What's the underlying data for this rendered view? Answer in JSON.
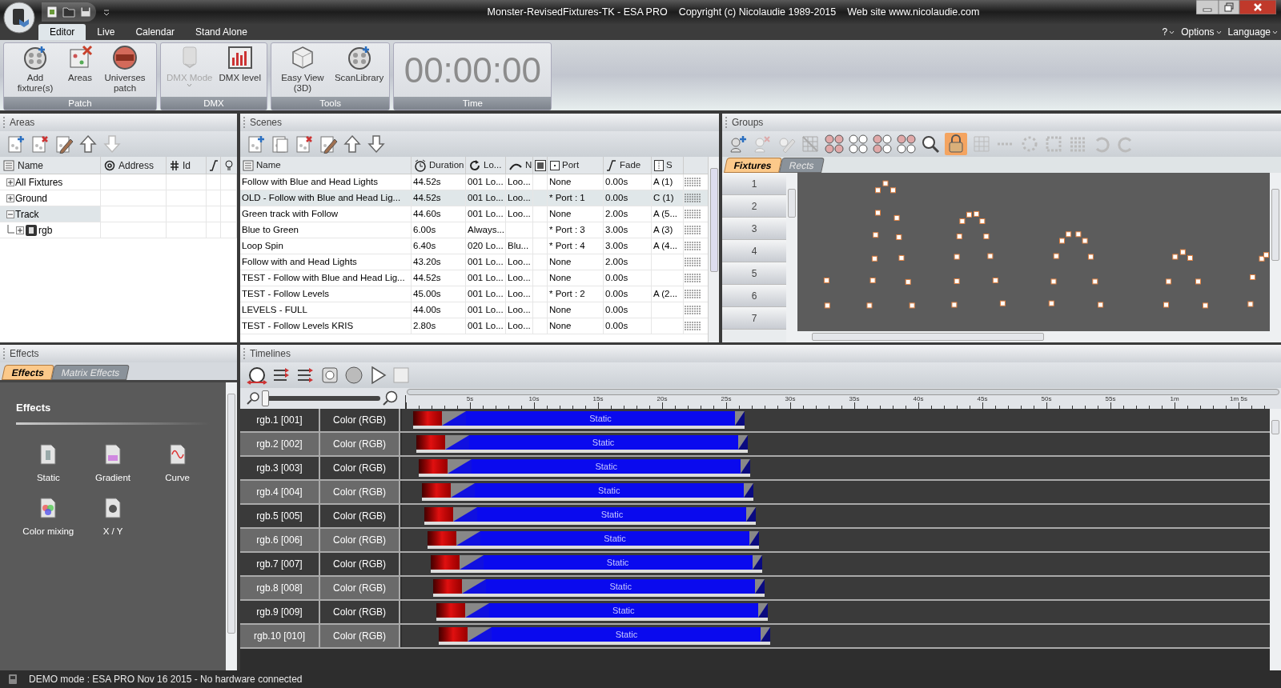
{
  "title_bar": {
    "texts": [
      "Monster-RevisedFixtures-TK - ESA PRO",
      "Copyright (c) Nicolaudie 1989-2015",
      "Web site www.nicolaudie.com"
    ]
  },
  "ribbon_tabs": [
    {
      "label": "Editor",
      "selected": true
    },
    {
      "label": "Live",
      "selected": false
    },
    {
      "label": "Calendar",
      "selected": false
    },
    {
      "label": "Stand Alone",
      "selected": false
    }
  ],
  "help_menus": [
    {
      "label": "?"
    },
    {
      "label": "Options"
    },
    {
      "label": "Language"
    }
  ],
  "ribbon_groups": [
    {
      "label": "Patch",
      "buttons": [
        {
          "label": "Add fixture(s)",
          "kind": "fixture",
          "disabled": false,
          "dropdown": false
        },
        {
          "label": "Areas",
          "kind": "areas",
          "disabled": false,
          "dropdown": false
        },
        {
          "label": "Universes patch",
          "kind": "dmx",
          "disabled": false,
          "dropdown": false
        }
      ]
    },
    {
      "label": "DMX",
      "buttons": [
        {
          "label": "DMX Mode",
          "kind": "mode",
          "disabled": true,
          "dropdown": true
        },
        {
          "label": "DMX level",
          "kind": "level",
          "disabled": false,
          "dropdown": false
        }
      ]
    },
    {
      "label": "Tools",
      "buttons": [
        {
          "label": "Easy View (3D)",
          "kind": "cube",
          "disabled": false,
          "dropdown": false
        },
        {
          "label": "ScanLibrary",
          "kind": "fixture",
          "disabled": false,
          "dropdown": false
        }
      ]
    },
    {
      "label": "Time",
      "clock": "00:00:00"
    }
  ],
  "areas": {
    "title": "Areas",
    "columns": [
      "Name",
      "Address",
      "Id"
    ],
    "rows": [
      {
        "label": "All Fixtures",
        "expanded": false,
        "selected": false
      },
      {
        "label": "Ground",
        "expanded": false,
        "selected": false
      },
      {
        "label": "Track",
        "expanded": true,
        "selected": true,
        "children": [
          {
            "label": "rgb",
            "expanded": false,
            "selected": false
          }
        ]
      }
    ]
  },
  "scenes": {
    "title": "Scenes",
    "columns": [
      "Name",
      "Duration",
      "Lo...",
      "N",
      "Port",
      "Fade",
      "S"
    ],
    "rows": [
      {
        "name": "Follow with Blue and Head Lights",
        "duration": "44.52s",
        "loop": "001 Lo...",
        "next": "Loo...",
        "port": "None",
        "fade": "0.00s",
        "s": "A (1)",
        "selected": false
      },
      {
        "name": "OLD - Follow with Blue and Head Lig...",
        "duration": "44.52s",
        "loop": "001 Lo...",
        "next": "Loo...",
        "port": "* Port : 1",
        "fade": "0.00s",
        "s": "C (1)",
        "selected": true
      },
      {
        "name": "Green track with Follow",
        "duration": "44.60s",
        "loop": "001 Lo...",
        "next": "Loo...",
        "port": "None",
        "fade": "2.00s",
        "s": "A (5...",
        "selected": false
      },
      {
        "name": "Blue to Green",
        "duration": "6.00s",
        "loop": "Always...",
        "port": "* Port : 3",
        "fade": "3.00s",
        "s": "A (3)",
        "selected": false
      },
      {
        "name": "Loop Spin",
        "duration": "6.40s",
        "loop": "020 Lo...",
        "next": "Blu...",
        "port": "* Port : 4",
        "fade": "3.00s",
        "s": "A (4...",
        "selected": false
      },
      {
        "name": "Follow with and Head Lights",
        "duration": "43.20s",
        "loop": "001 Lo...",
        "next": "Loo...",
        "port": "None",
        "fade": "2.00s",
        "selected": false
      },
      {
        "name": "TEST - Follow with Blue and Head Lig...",
        "duration": "44.52s",
        "loop": "001 Lo...",
        "next": "Loo...",
        "port": "None",
        "fade": "0.00s",
        "selected": false
      },
      {
        "name": "TEST - Follow Levels",
        "duration": "45.00s",
        "loop": "001 Lo...",
        "next": "Loo...",
        "port": "* Port : 2",
        "fade": "0.00s",
        "s": "A (2...",
        "selected": false
      },
      {
        "name": "LEVELS - FULL",
        "duration": "44.00s",
        "loop": "001 Lo...",
        "next": "Loo...",
        "port": "None",
        "fade": "0.00s",
        "selected": false
      },
      {
        "name": "TEST - Follow Levels KRIS",
        "duration": "2.80s",
        "loop": "001 Lo...",
        "next": "Loo...",
        "port": "None",
        "fade": "0.00s",
        "selected": false
      }
    ]
  },
  "groups": {
    "title": "Groups",
    "tabs": [
      {
        "label": "Fixtures",
        "selected": true
      },
      {
        "label": "Rects",
        "selected": false
      }
    ],
    "row_numbers": [
      "1",
      "2",
      "3",
      "4",
      "5",
      "6",
      "7"
    ]
  },
  "effects": {
    "title": "Effects",
    "tabs": [
      {
        "label": "Effects",
        "selected": true
      },
      {
        "label": "Matrix Effects",
        "selected": false
      }
    ],
    "heading": "Effects",
    "items": [
      {
        "label": "Static",
        "kind": "static"
      },
      {
        "label": "Gradient",
        "kind": "gradient"
      },
      {
        "label": "Curve",
        "kind": "curve"
      },
      {
        "label": "Color mixing",
        "kind": "mixing"
      },
      {
        "label": "X / Y",
        "kind": "xy"
      }
    ]
  },
  "timelines": {
    "title": "Timelines",
    "zoom": {
      "level": 0
    },
    "ruler": [
      "5s",
      "10s",
      "15s",
      "20s",
      "25s",
      "30s",
      "35s",
      "40s",
      "45s",
      "50s",
      "55s",
      "1m",
      "1m 5s"
    ],
    "tracks": [
      {
        "name": "rgb.1 [001]",
        "type": "Color (RGB)",
        "clip": "Static"
      },
      {
        "name": "rgb.2 [002]",
        "type": "Color (RGB)",
        "clip": "Static"
      },
      {
        "name": "rgb.3 [003]",
        "type": "Color (RGB)",
        "clip": "Static"
      },
      {
        "name": "rgb.4 [004]",
        "type": "Color (RGB)",
        "clip": "Static"
      },
      {
        "name": "rgb.5 [005]",
        "type": "Color (RGB)",
        "clip": "Static"
      },
      {
        "name": "rgb.6 [006]",
        "type": "Color (RGB)",
        "clip": "Static"
      },
      {
        "name": "rgb.7 [007]",
        "type": "Color (RGB)",
        "clip": "Static"
      },
      {
        "name": "rgb.8 [008]",
        "type": "Color (RGB)",
        "clip": "Static"
      },
      {
        "name": "rgb.9 [009]",
        "type": "Color (RGB)",
        "clip": "Static"
      },
      {
        "name": "rgb.10 [010]",
        "type": "Color (RGB)",
        "clip": "Static"
      }
    ]
  },
  "status_bar": {
    "text": "DEMO mode : ESA PRO Nov 16 2015 - No hardware connected"
  }
}
